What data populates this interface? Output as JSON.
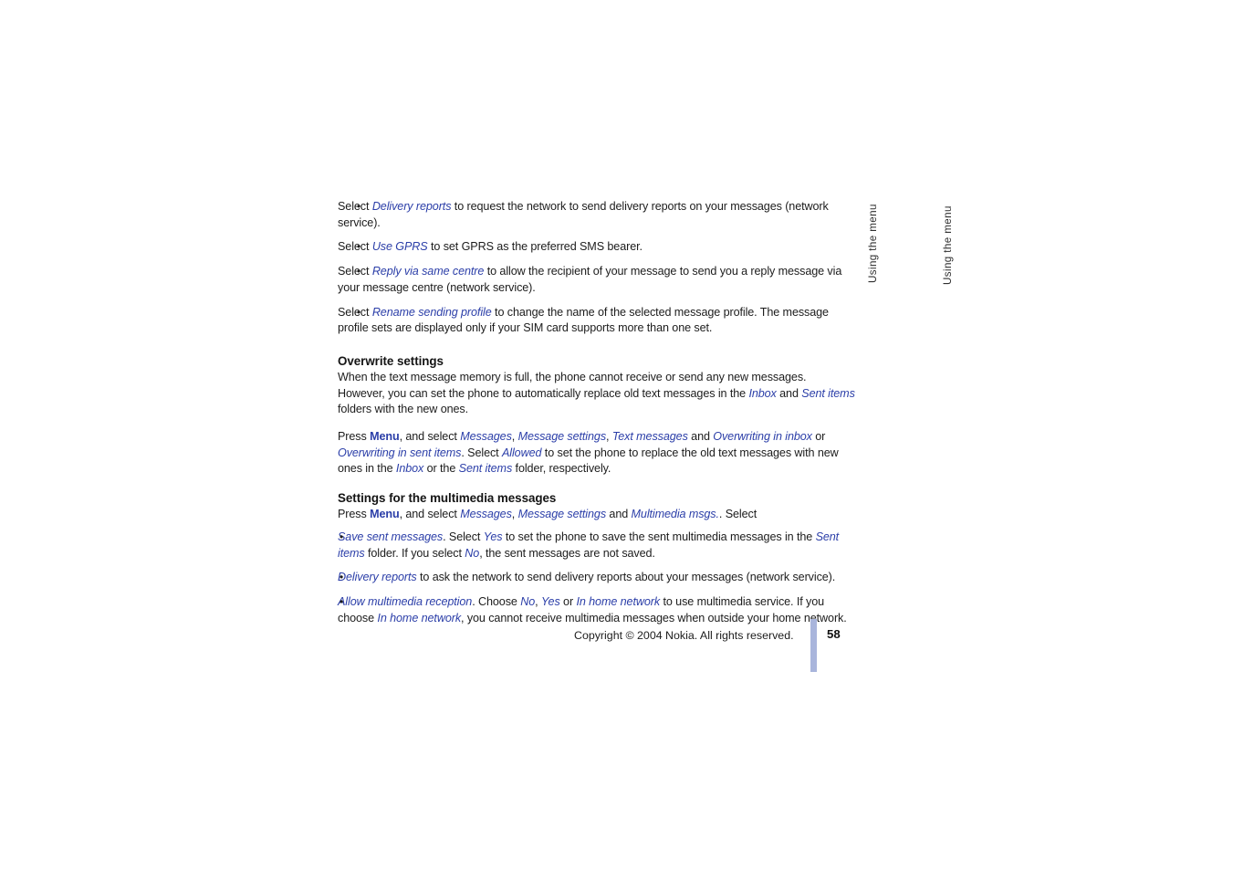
{
  "document": {
    "type": "user-guide-page",
    "page_number": "58",
    "footer_text": "Copyright © 2004 Nokia. All rights reserved.",
    "rule_color": "#a9b5dc",
    "ui_text_color": "#2b3ea8",
    "body_text_color": "#1c1c1c"
  },
  "running_heads": [
    {
      "label": "Using the menu"
    },
    {
      "label": "Using the menu"
    }
  ],
  "bullet_glyph": "•",
  "sms_settings_list": {
    "items": [
      {
        "parts": [
          {
            "t": "Select ",
            "s": "plain"
          },
          {
            "t": "Delivery reports",
            "s": "ui"
          },
          {
            "t": " to request the network to send delivery reports on your messages (network service).",
            "s": "plain"
          }
        ]
      },
      {
        "parts": [
          {
            "t": "Select ",
            "s": "plain"
          },
          {
            "t": "Use GPRS",
            "s": "ui"
          },
          {
            "t": " to set GPRS as the preferred SMS bearer.",
            "s": "plain"
          }
        ]
      },
      {
        "parts": [
          {
            "t": "Select ",
            "s": "plain"
          },
          {
            "t": "Reply via same centre",
            "s": "ui"
          },
          {
            "t": " to allow the recipient of your message to send you a reply message via your message centre (network service).",
            "s": "plain"
          }
        ]
      },
      {
        "parts": [
          {
            "t": "Select ",
            "s": "plain"
          },
          {
            "t": "Rename sending profile",
            "s": "ui"
          },
          {
            "t": " to change the name of the selected message profile. The message profile sets are displayed only if your SIM card supports more than one set.",
            "s": "plain"
          }
        ]
      }
    ]
  },
  "overwrite_section": {
    "heading": "Overwrite settings",
    "paragraph_1": {
      "parts": [
        {
          "t": "When the text message memory is full, the phone cannot receive or send any new messages. However, you can set the phone to automatically replace old text messages in the ",
          "s": "plain"
        },
        {
          "t": "Inbox",
          "s": "ui"
        },
        {
          "t": " and ",
          "s": "plain"
        },
        {
          "t": "Sent items",
          "s": "ui"
        },
        {
          "t": " folders with the new ones.",
          "s": "plain"
        }
      ]
    },
    "paragraph_2": {
      "parts": [
        {
          "t": "Press ",
          "s": "plain"
        },
        {
          "t": "Menu",
          "s": "key"
        },
        {
          "t": ", and select ",
          "s": "plain"
        },
        {
          "t": "Messages",
          "s": "ui"
        },
        {
          "t": ", ",
          "s": "plain"
        },
        {
          "t": "Message settings",
          "s": "ui"
        },
        {
          "t": ", ",
          "s": "plain"
        },
        {
          "t": "Text messages",
          "s": "ui"
        },
        {
          "t": " and ",
          "s": "plain"
        },
        {
          "t": "Overwriting in inbox",
          "s": "ui"
        },
        {
          "t": " or ",
          "s": "plain"
        },
        {
          "t": "Overwriting in sent items",
          "s": "ui"
        },
        {
          "t": ". Select ",
          "s": "plain"
        },
        {
          "t": "Allowed",
          "s": "ui"
        },
        {
          "t": " to set the phone to replace the old text messages with new ones in the ",
          "s": "plain"
        },
        {
          "t": "Inbox",
          "s": "ui"
        },
        {
          "t": " or the ",
          "s": "plain"
        },
        {
          "t": "Sent items",
          "s": "ui"
        },
        {
          "t": " folder, respectively.",
          "s": "plain"
        }
      ]
    }
  },
  "multimedia_section": {
    "heading": "Settings for the multimedia messages",
    "intro": {
      "parts": [
        {
          "t": "Press ",
          "s": "plain"
        },
        {
          "t": "Menu",
          "s": "key"
        },
        {
          "t": ", and select ",
          "s": "plain"
        },
        {
          "t": "Messages",
          "s": "ui"
        },
        {
          "t": ", ",
          "s": "plain"
        },
        {
          "t": "Message settings",
          "s": "ui"
        },
        {
          "t": " and ",
          "s": "plain"
        },
        {
          "t": "Multimedia msgs.",
          "s": "ui"
        },
        {
          "t": ". Select",
          "s": "plain"
        }
      ]
    },
    "items": [
      {
        "parts": [
          {
            "t": "Save sent messages",
            "s": "ui"
          },
          {
            "t": ". Select ",
            "s": "plain"
          },
          {
            "t": "Yes",
            "s": "ui"
          },
          {
            "t": " to set the phone to save the sent multimedia messages in the ",
            "s": "plain"
          },
          {
            "t": "Sent items",
            "s": "ui"
          },
          {
            "t": " folder. If you select ",
            "s": "plain"
          },
          {
            "t": "No",
            "s": "ui"
          },
          {
            "t": ", the sent messages are not saved.",
            "s": "plain"
          }
        ]
      },
      {
        "parts": [
          {
            "t": "Delivery reports",
            "s": "ui"
          },
          {
            "t": " to ask the network to send delivery reports about your messages (network service).",
            "s": "plain"
          }
        ]
      },
      {
        "parts": [
          {
            "t": "Allow multimedia reception",
            "s": "ui"
          },
          {
            "t": ". Choose ",
            "s": "plain"
          },
          {
            "t": "No",
            "s": "ui"
          },
          {
            "t": ", ",
            "s": "plain"
          },
          {
            "t": "Yes",
            "s": "ui"
          },
          {
            "t": " or ",
            "s": "plain"
          },
          {
            "t": "In home network",
            "s": "ui"
          },
          {
            "t": " to use multimedia service. If you choose ",
            "s": "plain"
          },
          {
            "t": "In home network",
            "s": "ui"
          },
          {
            "t": ", you cannot receive multimedia messages when outside your home network.",
            "s": "plain"
          }
        ]
      }
    ]
  }
}
